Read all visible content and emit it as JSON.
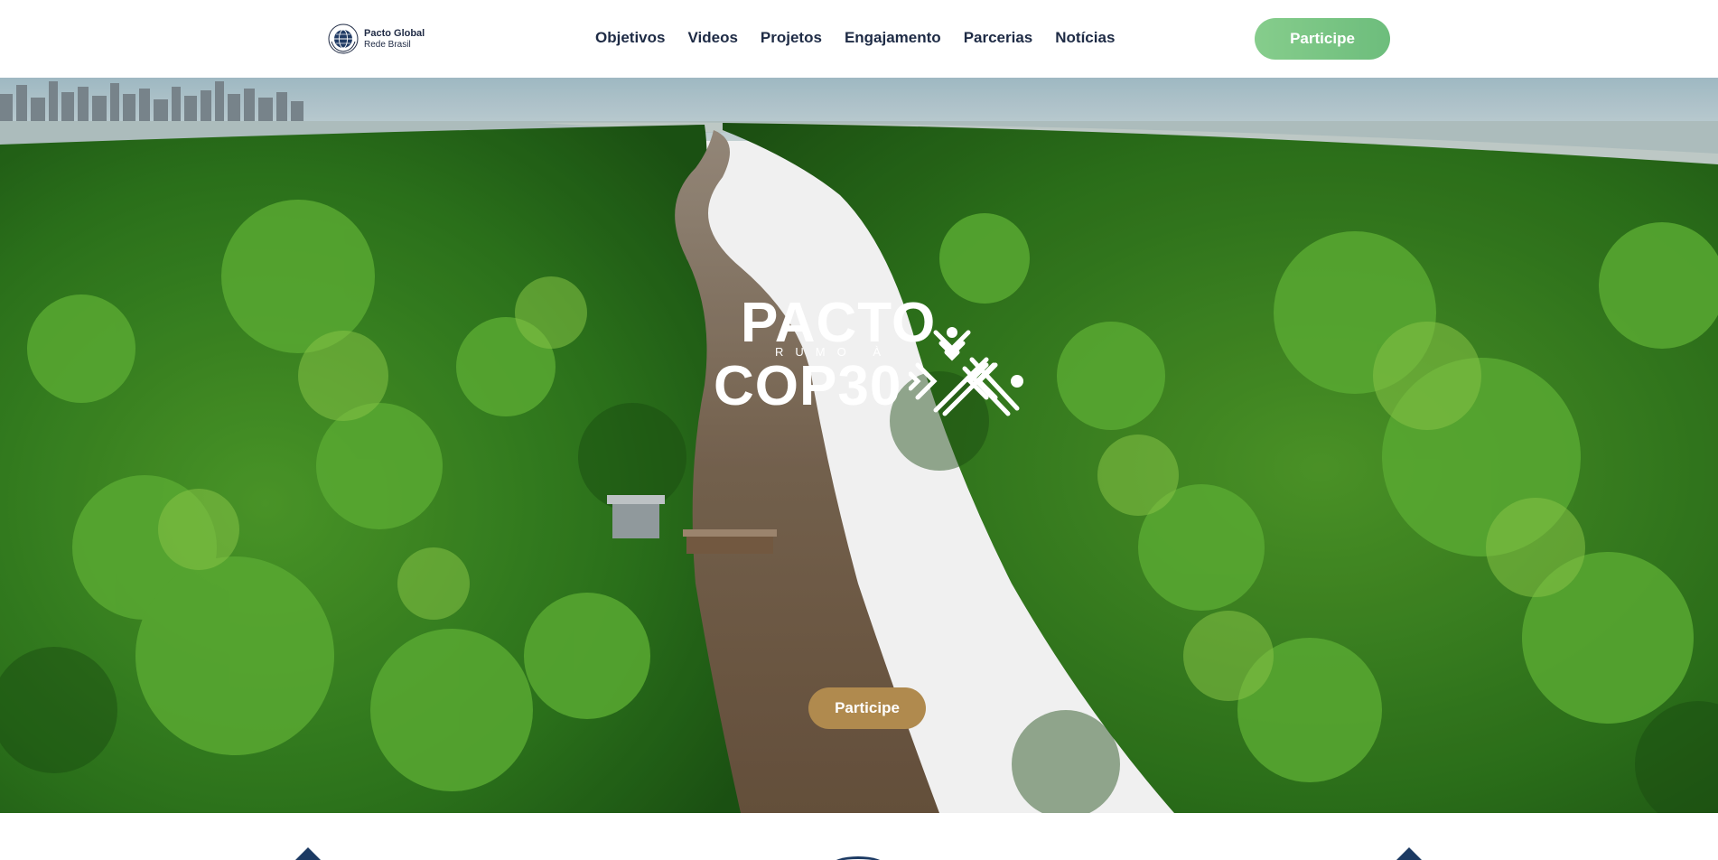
{
  "header": {
    "logo": {
      "line1": "Pacto Global",
      "line2": "Rede Brasil",
      "icon": "globe-icon"
    },
    "nav": [
      {
        "label": "Objetivos"
      },
      {
        "label": "Videos"
      },
      {
        "label": "Projetos"
      },
      {
        "label": "Engajamento"
      },
      {
        "label": "Parcerias"
      },
      {
        "label": "Notícias"
      }
    ],
    "cta_label": "Participe"
  },
  "hero": {
    "background": "aerial-rainforest-river-photo",
    "logo": {
      "line1": "PACTO",
      "line2": "RUMO À",
      "line3": "COP30",
      "mark": "cop30-emblem-icon"
    },
    "cta_label": "Participe"
  },
  "colors": {
    "nav_text": "#1e2b45",
    "cta_top": "#7cc788",
    "cta_hero": "#b08a4e",
    "accent_dark": "#1c3a63"
  }
}
